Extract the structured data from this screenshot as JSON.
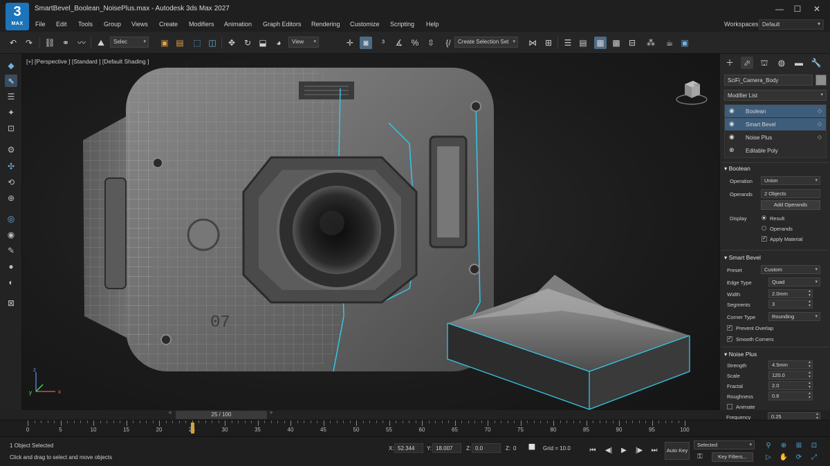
{
  "window": {
    "logo_number": "3",
    "logo_text": "MAX",
    "title": "SmartBevel_Boolean_NoisePlus.max - Autodesk 3ds Max 2027",
    "minimize": "—",
    "maximize": "☐",
    "close": "✕"
  },
  "menu": [
    "File",
    "Edit",
    "Tools",
    "Group",
    "Views",
    "Create",
    "Modifiers",
    "Animation",
    "Graph Editors",
    "Rendering",
    "Customize",
    "Scripting",
    "Help"
  ],
  "workspaces": {
    "label": "Workspaces:",
    "value": "Default"
  },
  "toolbar": {
    "selection_filter": "Selec",
    "ref_coord": "View",
    "named_selection": "Create Selection Set"
  },
  "viewport": {
    "label": "[+]  [Perspective ]  [Standard ]  [Default Shading ]",
    "model_text": "07",
    "viewcube_label": "TOP",
    "axis_z": "z",
    "axis_y": "y",
    "axis_x": "x"
  },
  "command_panel": {
    "object_name": "SciFi_Camera_Body",
    "object_color": "#8e8e8e",
    "modifier_list": "Modifier List",
    "stack": [
      {
        "label": "Boolean",
        "selected": true
      },
      {
        "label": "Smart Bevel",
        "selected": true
      },
      {
        "label": "Noise Plus",
        "selected": false
      },
      {
        "label": "Editable Poly",
        "selected": false
      }
    ],
    "boolean": {
      "title": "Boolean",
      "operation_label": "Operation",
      "operation_value": "Union",
      "operands_label": "Operands",
      "operands_value": "2 Objects",
      "add_operands": "Add Operands",
      "display_label": "Display",
      "result": "Result",
      "operands": "Operands",
      "apply_material": "Apply Material"
    },
    "smart_bevel": {
      "title": "Smart Bevel",
      "preset_label": "Preset",
      "preset_value": "Custom",
      "edge_type_label": "Edge Type",
      "edge_type_value": "Quad",
      "width_label": "Width",
      "width_value": "2.0mm",
      "segments_label": "Segments",
      "segments_value": "3",
      "corner_type_label": "Corner Type",
      "corner_type_value": "Rounding",
      "prevent_overlap": "Prevent Overlap",
      "smooth_corners": "Smooth Corners"
    },
    "noise_plus": {
      "title": "Noise Plus",
      "strength_label": "Strength",
      "strength_value": "4.5mm",
      "scale_label": "Scale",
      "scale_value": "120.0",
      "fractal_label": "Fractal",
      "fractal_value": "2.0",
      "roughness_label": "Roughness",
      "roughness_value": "0.6",
      "animate": "Animate",
      "frequency_label": "Frequency",
      "frequency_value": "0.25"
    }
  },
  "timeline": {
    "frame": "25 / 100",
    "current_frame": 25,
    "prev": "<",
    "next": ">",
    "ticks": [
      "0",
      "5",
      "10",
      "15",
      "20",
      "25",
      "30",
      "35",
      "40",
      "45",
      "50",
      "55",
      "60",
      "65",
      "70",
      "75",
      "80",
      "85",
      "90",
      "95",
      "100"
    ]
  },
  "status": {
    "selection_info": "1 Object Selected",
    "prompt": "Click and drag to select and move objects",
    "x_label": "X:",
    "x_value": "52.344",
    "y_label": "Y:",
    "y_value": "18.007",
    "z_label": "Z:",
    "z_value": "0.0",
    "z2_label": "Z:",
    "z2_value": "0",
    "grid": "Grid = 10.0",
    "auto_key": "Auto Key",
    "selected": "Selected",
    "key_filters": "Key Filters..."
  },
  "colors": {
    "accent": "#3e5d7a",
    "highlight_cyan": "#35c6e6",
    "logo_blue": "#1e74b8",
    "playhead": "#d4a43a"
  }
}
